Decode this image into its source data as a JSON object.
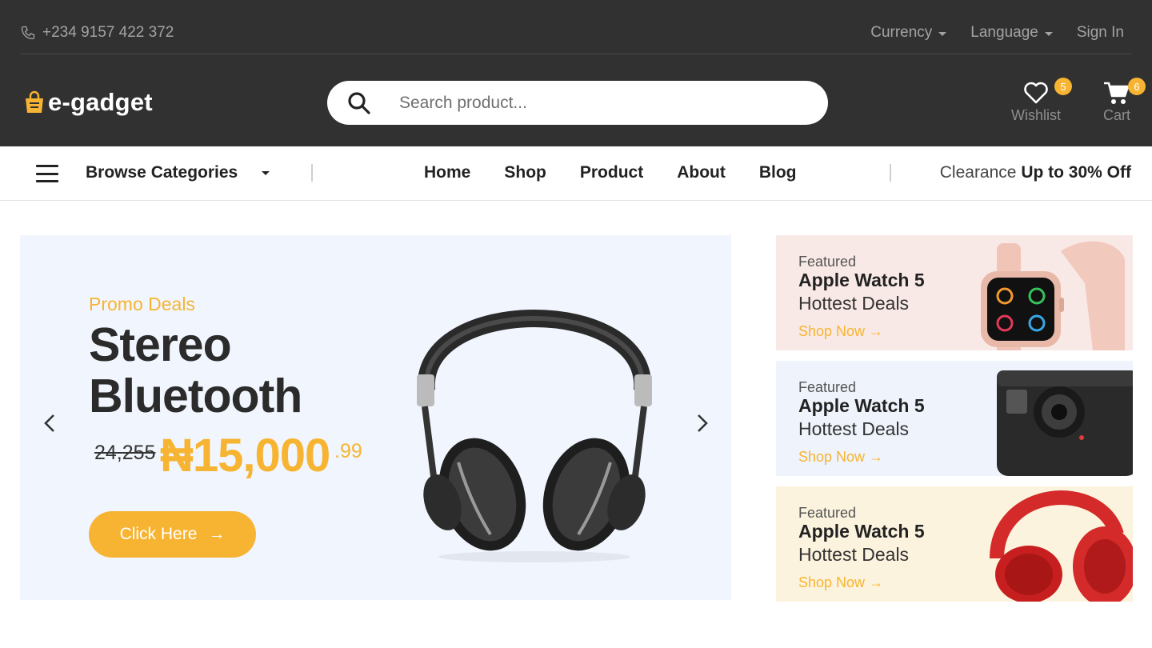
{
  "topbar": {
    "phone": "+234 9157 422 372",
    "currency_label": "Currency",
    "language_label": "Language",
    "signin_label": "Sign In"
  },
  "header": {
    "logo_text": "e-gadget",
    "search_placeholder": "Search product...",
    "wishlist": {
      "label": "Wishlist",
      "count": "5"
    },
    "cart": {
      "label": "Cart",
      "count": "6"
    }
  },
  "nav": {
    "browse_label": "Browse Categories",
    "links": [
      "Home",
      "Shop",
      "Product",
      "About",
      "Blog"
    ],
    "clearance_prefix": "Clearance",
    "clearance_offer": "Up to 30% Off"
  },
  "hero": {
    "promo": "Promo Deals",
    "title_line1": "Stereo",
    "title_line2": "Bluetooth",
    "old_price": "24,255",
    "new_price": "₦15,000",
    "cents": ".99",
    "cta_label": "Click Here",
    "cta_arrow": "→"
  },
  "banners": [
    {
      "featured": "Featured",
      "title": "Apple Watch 5",
      "subtitle": "Hottest Deals",
      "link": "Shop Now →"
    },
    {
      "featured": "Featured",
      "title": "Apple Watch 5",
      "subtitle": "Hottest Deals",
      "link": "Shop Now →"
    },
    {
      "featured": "Featured",
      "title": "Apple Watch 5",
      "subtitle": "Hottest Deals",
      "link": "Shop Now →"
    }
  ],
  "colors": {
    "header_bg": "#313131",
    "accent": "#f6b432",
    "hero_bg": "#f1f5fd",
    "banner1_bg": "#f9e9e6",
    "banner2_bg": "#eef3fc",
    "banner3_bg": "#fcf3de"
  }
}
